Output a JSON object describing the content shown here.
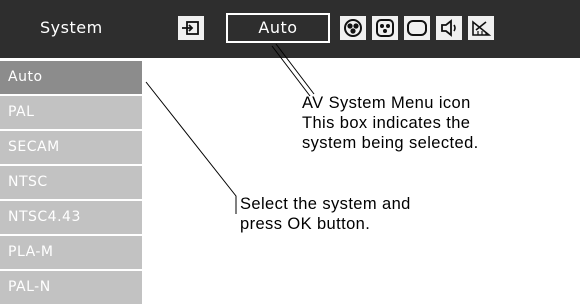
{
  "menu": {
    "title": "System",
    "system_box_value": "Auto",
    "icons": [
      "input-icon",
      "av-system-icon",
      "image-adjust-icon",
      "color-adjust-icon",
      "screen-icon",
      "sound-icon",
      "setting-icon"
    ]
  },
  "system_list": {
    "items": [
      "Auto",
      "PAL",
      "SECAM",
      "NTSC",
      "NTSC4.43",
      "PLA-M",
      "PAL-N"
    ],
    "selected": "Auto"
  },
  "callout_icon": {
    "title_bold": "AV System Menu",
    "title_rest": " icon",
    "line2": "This box indicates the",
    "line3": "system being selected."
  },
  "callout_select": {
    "line1": "Select the system and",
    "line2_pre": "press ",
    "line2_bold": "OK",
    "line2_post": " button."
  },
  "colors": {
    "menubar": "#2e2e2e",
    "list_item": "#c2c2c2",
    "list_selected": "#8c8c8c"
  }
}
